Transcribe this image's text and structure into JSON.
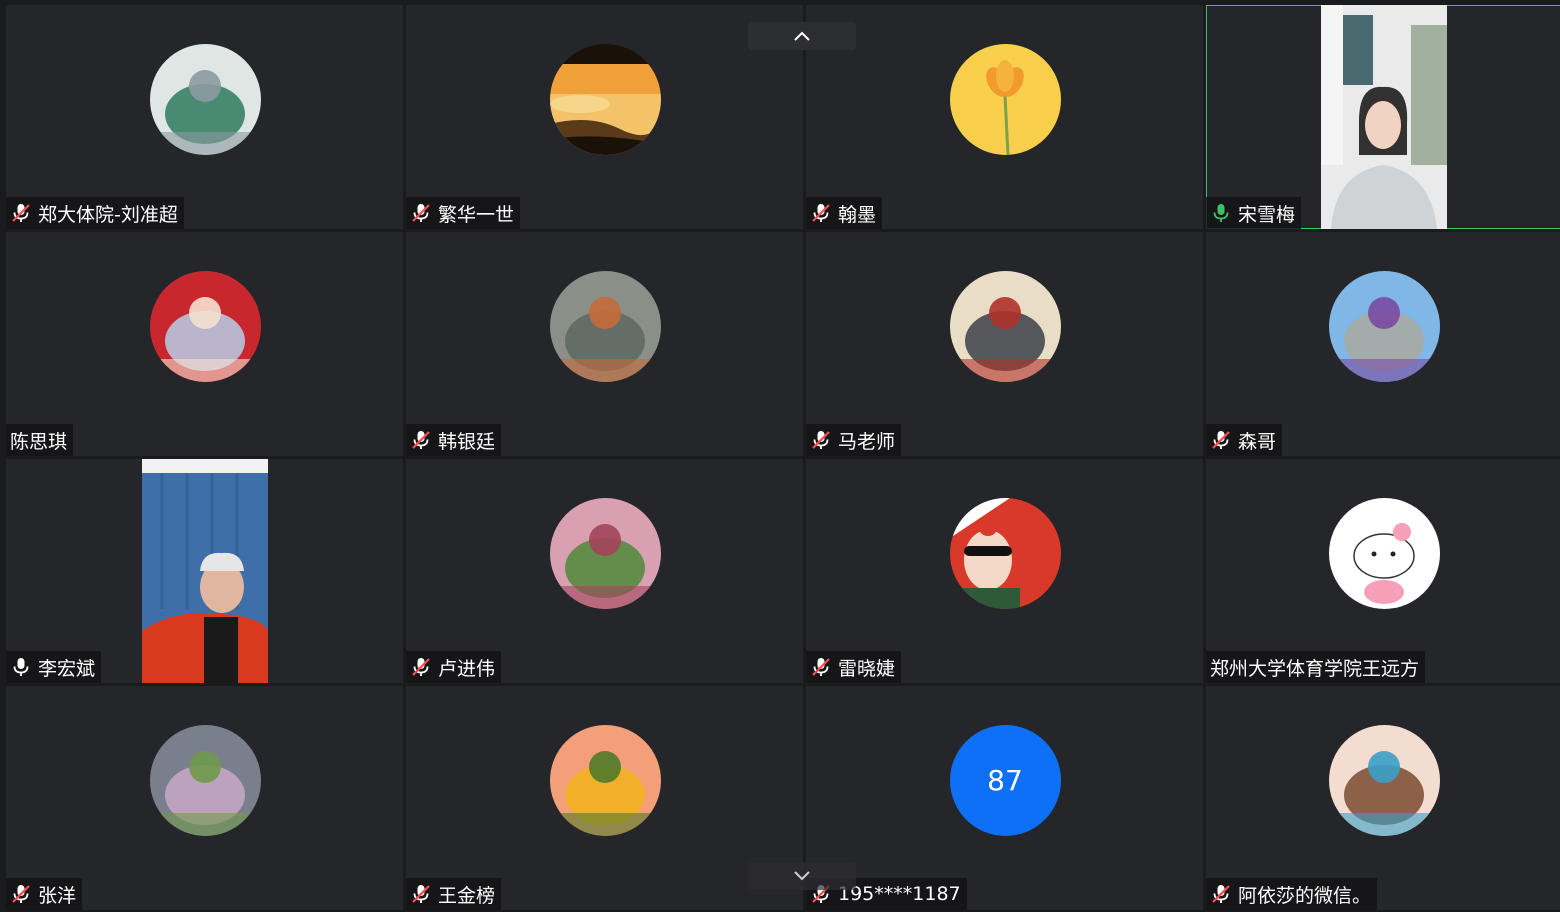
{
  "participants": [
    {
      "name": "郑大体院-刘准超",
      "mic": "muted",
      "display": "avatar",
      "avatar_icon": "person-in-snow-photo",
      "colors": [
        "#dfe6e3",
        "#2f7a5e",
        "#8a9aa0"
      ]
    },
    {
      "name": "繁华一世",
      "mic": "muted",
      "display": "avatar",
      "avatar_icon": "sunset-cloud-sea-photo",
      "colors": [
        "#f0a13a",
        "#5a3a18",
        "#1a1208"
      ]
    },
    {
      "name": "翰墨",
      "mic": "muted",
      "display": "avatar",
      "avatar_icon": "yellow-flower-photo",
      "colors": [
        "#f7cf4a",
        "#f29a2e",
        "#7fa04a"
      ]
    },
    {
      "name": "宋雪梅",
      "mic": "on",
      "display": "video",
      "avatar_icon": "woman-video-feed",
      "colors": [
        "#eaeaea",
        "#cfd3d6",
        "#1e1e1e"
      ]
    },
    {
      "name": "陈思琪",
      "mic": "none",
      "display": "avatar",
      "avatar_icon": "girl-red-wall-photo",
      "colors": [
        "#c8282d",
        "#b9cdea",
        "#f5e0d0"
      ]
    },
    {
      "name": "韩银廷",
      "mic": "muted",
      "display": "avatar",
      "avatar_icon": "pond-fish-photo",
      "colors": [
        "#8a8f88",
        "#5e6960",
        "#c46a3a"
      ]
    },
    {
      "name": "马老师",
      "mic": "muted",
      "display": "avatar",
      "avatar_icon": "man-speaking-photo",
      "colors": [
        "#e9ddc6",
        "#3c3f48",
        "#b0322a"
      ]
    },
    {
      "name": "森哥",
      "mic": "muted",
      "display": "avatar",
      "avatar_icon": "man-mountain-photo",
      "colors": [
        "#7fb7e6",
        "#a9a9a0",
        "#7a4aa0"
      ]
    },
    {
      "name": "李宏斌",
      "mic": "unmuted",
      "display": "video",
      "avatar_icon": "man-video-feed",
      "colors": [
        "#3e6fa8",
        "#d8391f",
        "#1a1a1a"
      ]
    },
    {
      "name": "卢进伟",
      "mic": "muted",
      "display": "avatar",
      "avatar_icon": "blossom-trees-photo",
      "colors": [
        "#d9a0b2",
        "#4f8a3a",
        "#a3445a"
      ]
    },
    {
      "name": "雷晓婕",
      "mic": "muted",
      "display": "avatar",
      "avatar_icon": "cartoon-girl-sunglasses",
      "colors": [
        "#d8392b",
        "#ffffff",
        "#2e5a3a"
      ]
    },
    {
      "name": "郑州大学体育学院王远方",
      "mic": "none",
      "display": "avatar",
      "avatar_icon": "hello-kitty-avatar",
      "colors": [
        "#ffffff",
        "#f5a0b8",
        "#222222"
      ]
    },
    {
      "name": "张洋",
      "mic": "muted",
      "display": "avatar",
      "avatar_icon": "flower-field-landscape-photo",
      "colors": [
        "#7a7f8e",
        "#c9a8c8",
        "#6f9a4a"
      ]
    },
    {
      "name": "王金榜",
      "mic": "muted",
      "display": "avatar",
      "avatar_icon": "sunflower-sunset-photo",
      "colors": [
        "#f3a07a",
        "#f2b31c",
        "#4f7a2a"
      ]
    },
    {
      "name": "195****1187",
      "mic": "muted",
      "display": "initials",
      "initials": "87",
      "avatar_icon": "initials-avatar",
      "colors": [
        "#0e6ff7",
        "#ffffff",
        "#0e6ff7"
      ]
    },
    {
      "name": "阿依莎的微信。",
      "mic": "muted",
      "display": "avatar",
      "avatar_icon": "anime-girl-avatar",
      "colors": [
        "#f3dcd0",
        "#7a4a30",
        "#3aa0c8"
      ]
    }
  ],
  "nav": {
    "up_icon": "chevron-up-icon",
    "down_icon": "chevron-down-icon"
  },
  "theme": {
    "active_speaker_border": "#3fbf6a",
    "mic_muted": "#ff4d4f",
    "mic_on": "#3fbf6a",
    "tile_bg": "#25262a"
  }
}
